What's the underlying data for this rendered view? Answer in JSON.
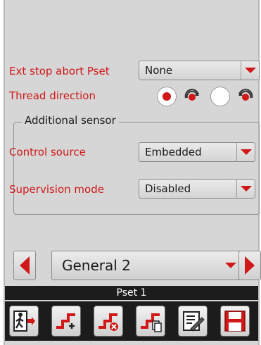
{
  "settings": {
    "ext_stop_abort_pset": {
      "label": "Ext stop abort Pset",
      "value": "None"
    },
    "thread_direction": {
      "label": "Thread direction",
      "selected": "clockwise"
    }
  },
  "additional_sensor": {
    "title": "Additional sensor",
    "control_source": {
      "label": "Control source",
      "value": "Embedded"
    },
    "supervision_mode": {
      "label": "Supervision mode",
      "value": "Disabled"
    }
  },
  "navigation": {
    "current_page": "General 2"
  },
  "status": {
    "text": "Pset 1"
  },
  "toolbar": {
    "buttons": [
      "exit-icon",
      "add-step-icon",
      "delete-step-icon",
      "copy-step-icon",
      "edit-icon",
      "save-icon"
    ]
  },
  "colors": {
    "accent": "#d01818",
    "background": "#d6d6d6",
    "bar": "#1c1c1c"
  }
}
